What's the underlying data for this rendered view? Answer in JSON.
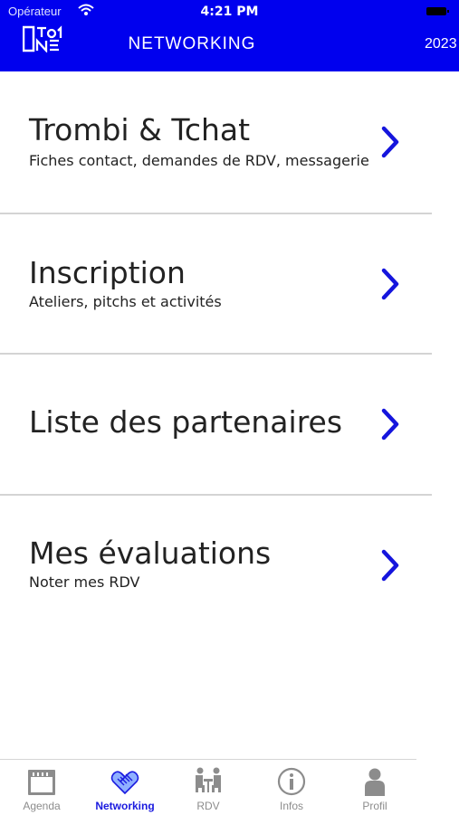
{
  "status_bar": {
    "carrier": "Opérateur",
    "time": "4:21 PM"
  },
  "header": {
    "title": "NETWORKING",
    "year": "2023"
  },
  "menu": [
    {
      "title": "Trombi & Tchat",
      "subtitle": "Fiches contact, demandes de RDV, messagerie"
    },
    {
      "title": "Inscription",
      "subtitle": "Ateliers, pitchs et activités"
    },
    {
      "title": "Liste des partenaires",
      "subtitle": ""
    },
    {
      "title": "Mes évaluations",
      "subtitle": "Noter mes RDV"
    }
  ],
  "tabs": [
    {
      "label": "Agenda",
      "icon": "calendar-icon"
    },
    {
      "label": "Networking",
      "icon": "handshake-icon",
      "active": true
    },
    {
      "label": "RDV",
      "icon": "meeting-icon"
    },
    {
      "label": "Infos",
      "icon": "info-icon"
    },
    {
      "label": "Profil",
      "icon": "person-icon"
    }
  ],
  "colors": {
    "brand_blue": "#0000ee",
    "chevron": "#1515dd",
    "tab_inactive": "#8c8c8c"
  }
}
